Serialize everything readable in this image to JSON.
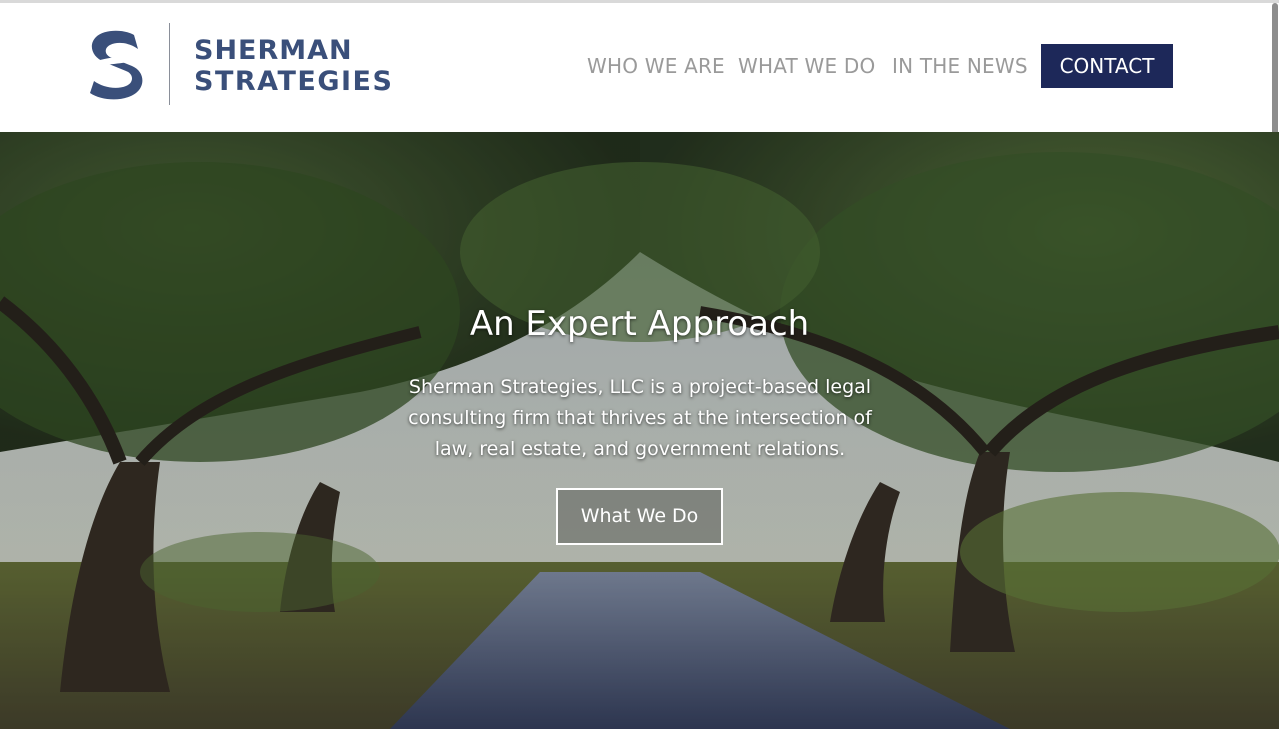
{
  "header": {
    "logo": {
      "line1": "SHERMAN",
      "line2": "STRATEGIES",
      "mark_icon": "sherman-s-logo-icon",
      "color": "#3a4f7a"
    },
    "nav": {
      "who_we_are": "WHO WE ARE",
      "what_we_do": "WHAT WE DO",
      "in_the_news": "IN THE NEWS",
      "contact": "CONTACT"
    },
    "colors": {
      "nav_text": "#9a9a9a",
      "contact_bg": "#1d2859",
      "contact_text": "#ffffff"
    }
  },
  "hero": {
    "title": "An Expert Approach",
    "body": "Sherman Strategies, LLC is a project-based legal consulting firm that thrives at the intersection of law, real estate, and government relations.",
    "button": "What We Do",
    "background": "oak-tree-alley-photo"
  }
}
